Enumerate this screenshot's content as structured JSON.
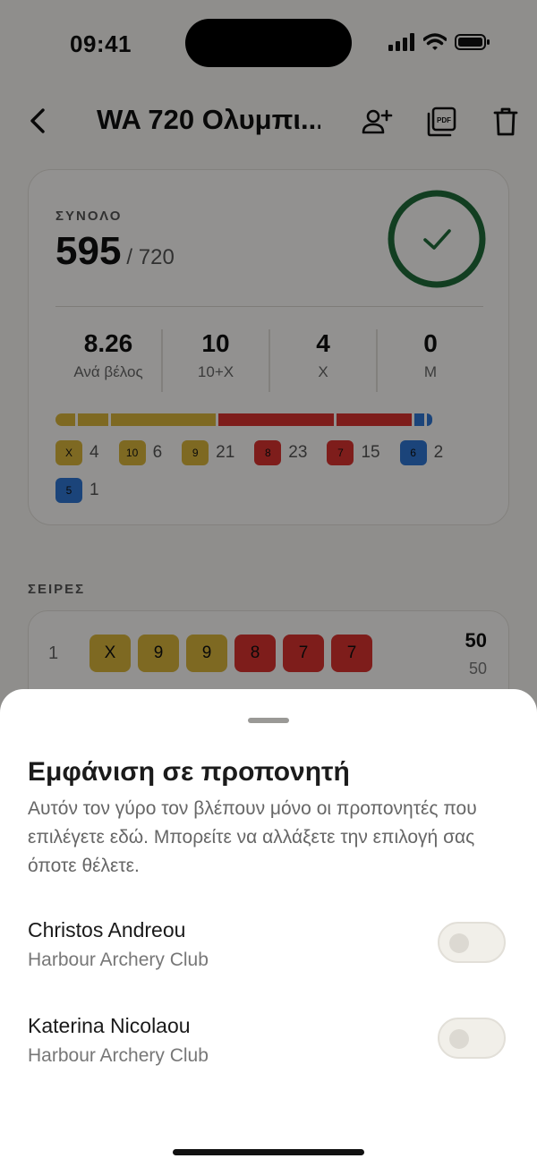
{
  "status": {
    "time": "09:41"
  },
  "header": {
    "title": "WA 720 Ολυμπι..."
  },
  "summary": {
    "total_label": "ΣΥΝΟΛΟ",
    "total": "595",
    "total_of": "/ 720",
    "stats": [
      {
        "value": "8.26",
        "label": "Ανά βέλος"
      },
      {
        "value": "10",
        "label": "10+X"
      },
      {
        "value": "4",
        "label": "X"
      },
      {
        "value": "0",
        "label": "M"
      }
    ],
    "legend": [
      {
        "score": "X",
        "count": "4",
        "color": "#d9b63c"
      },
      {
        "score": "10",
        "count": "6",
        "color": "#d9b63c"
      },
      {
        "score": "9",
        "count": "21",
        "color": "#d9b63c"
      },
      {
        "score": "8",
        "count": "23",
        "color": "#d9322f"
      },
      {
        "score": "7",
        "count": "15",
        "color": "#d9322f"
      },
      {
        "score": "6",
        "count": "2",
        "color": "#2f76d2"
      },
      {
        "score": "5",
        "count": "1",
        "color": "#2f76d2"
      }
    ]
  },
  "series_section": {
    "label": "ΣΕΙΡΕΣ",
    "rows": [
      {
        "num": "1",
        "arrows": [
          "X",
          "9",
          "9",
          "8",
          "7",
          "7"
        ],
        "end_total": "50",
        "running_total": "50"
      }
    ]
  },
  "sheet": {
    "title": "Εμφάνιση σε προπονητή",
    "description": "Αυτόν τον γύρο τον βλέπουν μόνο οι προπονητές που επιλέγετε εδώ. Μπορείτε να αλλάξετε την επιλογή σας όποτε θέλετε.",
    "coaches": [
      {
        "name": "Christos Andreou",
        "club": "Harbour Archery Club",
        "enabled": false
      },
      {
        "name": "Katerina Nicolaou",
        "club": "Harbour Archery Club",
        "enabled": false
      }
    ]
  },
  "colors": {
    "gold": "#d9b63c",
    "red": "#d9322f",
    "blue": "#2f76d2",
    "ring": "#1f6b3a"
  }
}
